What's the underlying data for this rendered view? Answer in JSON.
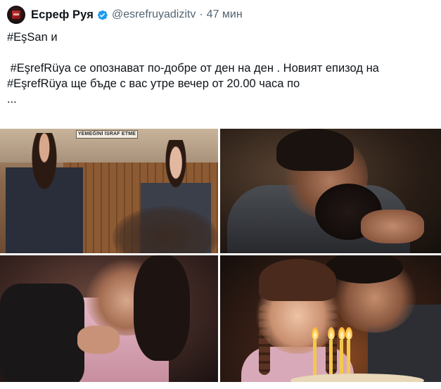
{
  "author": {
    "display_name": "Есреф Руя",
    "handle": "@esrefruyadizitv",
    "separator": "·",
    "time": "47 мин",
    "avatar_icon": "channel-logo-avatar",
    "verified_icon": "verified-badge-icon",
    "verified_color": "#1d9bf0"
  },
  "tweet": {
    "line1": "#EşSan и",
    "line2": " #EşrefRüya се опознават по-добре от ден на ден . Новият епизод на",
    "line3": "#EşrefRüya ще бъде с вас утре вечер от 20.00 часа по",
    "line4": "..."
  },
  "media": {
    "photo1": {
      "sign_text": "YEMEĞİNİ İSRAF ETME"
    }
  }
}
